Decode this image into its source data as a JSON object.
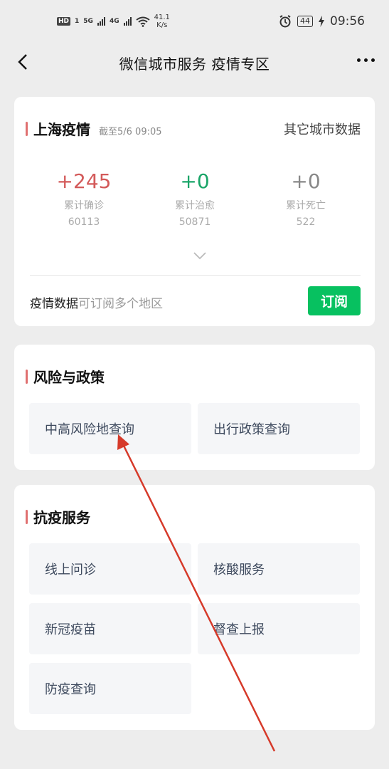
{
  "status_bar": {
    "hd": "HD",
    "sim1": "1",
    "net1": "5G",
    "net2": "4G",
    "speed_value": "41.1",
    "speed_unit": "K/s",
    "battery": "44",
    "time": "09:56"
  },
  "nav": {
    "title": "微信城市服务 疫情专区"
  },
  "epidemic": {
    "title": "上海疫情",
    "updated": "截至5/6 09:05",
    "other_cities_link": "其它城市数据",
    "stats": [
      {
        "delta": "+245",
        "label": "累计确诊",
        "value": "60113",
        "color": "#d35a5a"
      },
      {
        "delta": "+0",
        "label": "累计治愈",
        "value": "50871",
        "color": "#1aa568"
      },
      {
        "delta": "+0",
        "label": "累计死亡",
        "value": "522",
        "color": "#888888"
      }
    ],
    "subscribe_strong": "疫情数据",
    "subscribe_hint": "可订阅多个地区",
    "subscribe_button": "订阅"
  },
  "risk_policy": {
    "title": "风险与政策",
    "tiles": [
      "中高风险地查询",
      "出行政策查询"
    ]
  },
  "services": {
    "title": "抗疫服务",
    "tiles": [
      "线上问诊",
      "核酸服务",
      "新冠疫苗",
      "督查上报",
      "防疫查询"
    ]
  },
  "colors": {
    "accent_green": "#07c160",
    "section_marker": "#e07070",
    "annotation_arrow": "#d63a2a"
  }
}
